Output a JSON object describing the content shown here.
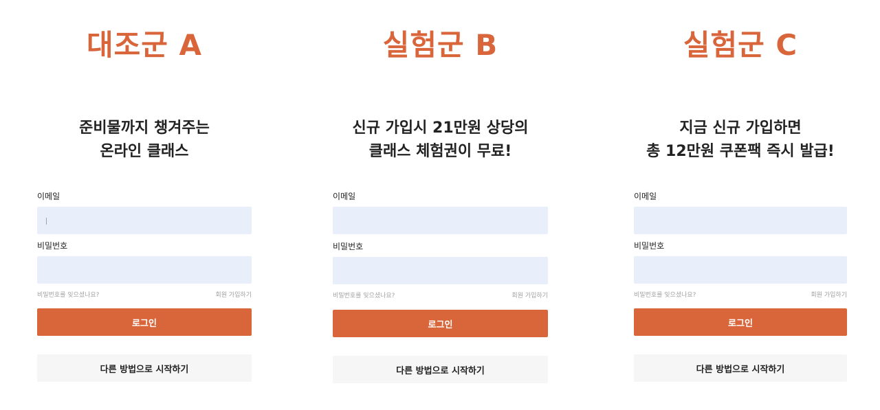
{
  "panels": [
    {
      "group_title": "대조군 A",
      "headline_line1": "준비물까지 챙겨주는",
      "headline_line2": "온라인 클래스",
      "email_label": "이메일",
      "password_label": "비밀번호",
      "forgot_password": "비밀번호를 잊으셨나요?",
      "signup_link": "회원 가입하기",
      "login_button": "로그인",
      "alt_start_button": "다른 방법으로 시작하기"
    },
    {
      "group_title": "실험군 B",
      "headline_line1": "신규 가입시 21만원 상당의",
      "headline_line2": "클래스 체험권이 무료!",
      "email_label": "이메일",
      "password_label": "비밀번호",
      "forgot_password": "비밀번호를 잊으셨나요?",
      "signup_link": "회원 가입하기",
      "login_button": "로그인",
      "alt_start_button": "다른 방법으로 시작하기"
    },
    {
      "group_title": "실험군 C",
      "headline_line1": "지금 신규 가입하면",
      "headline_line2": "총 12만원 쿠폰팩 즉시 발급!",
      "email_label": "이메일",
      "password_label": "비밀번호",
      "forgot_password": "비밀번호를 잊으셨나요?",
      "signup_link": "회원 가입하기",
      "login_button": "로그인",
      "alt_start_button": "다른 방법으로 시작하기"
    }
  ],
  "colors": {
    "accent": "#d9663b",
    "input_background": "#e8effb",
    "secondary_button_background": "#f6f6f6",
    "helper_text": "#a0a0a0"
  }
}
